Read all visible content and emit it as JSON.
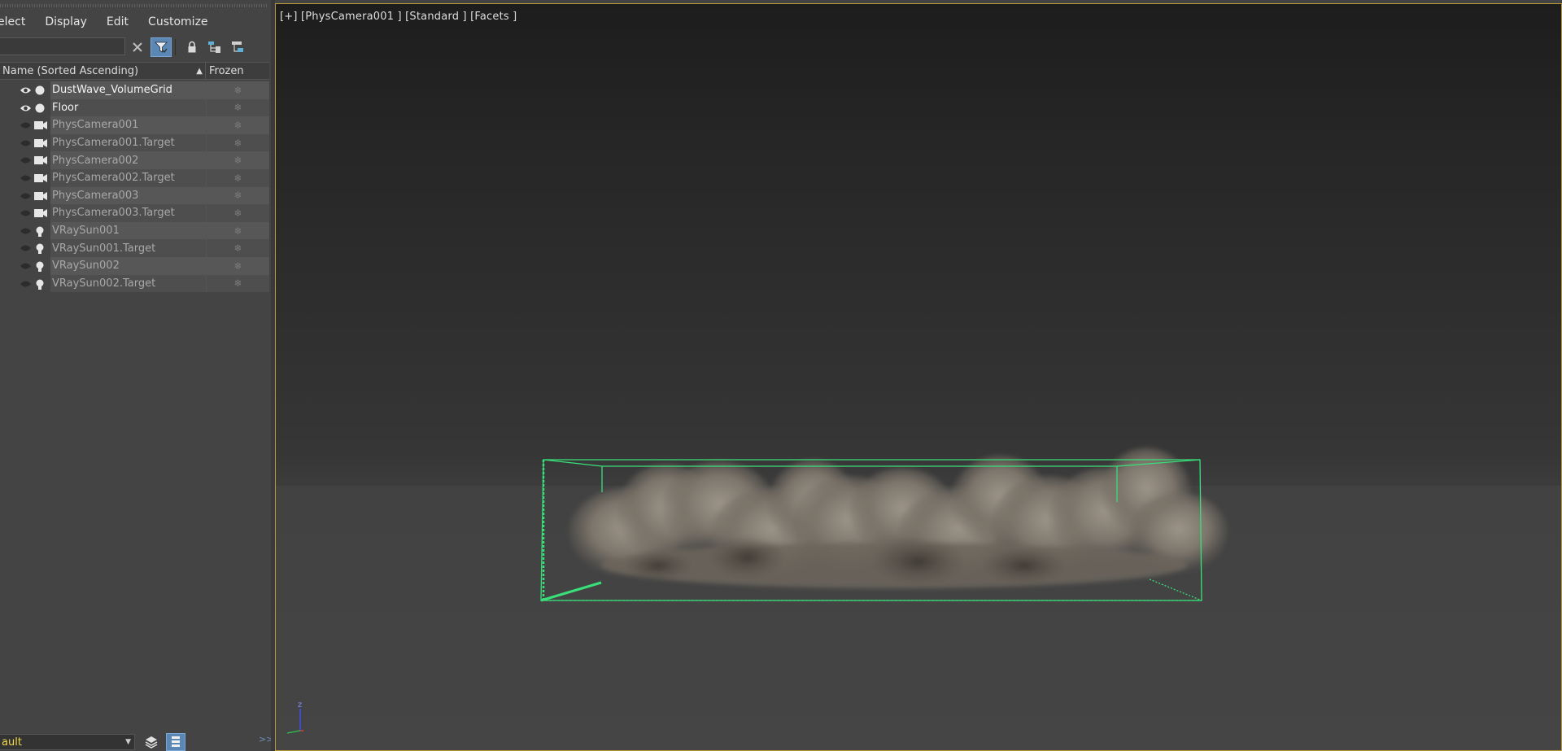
{
  "menu": {
    "select": "elect",
    "display": "Display",
    "edit": "Edit",
    "customize": "Customize"
  },
  "search": {
    "value": "",
    "placeholder": ""
  },
  "columns": {
    "name": "Name (Sorted Ascending)",
    "sort_indicator": "▲",
    "frozen": "Frozen"
  },
  "objects": [
    {
      "name": "DustWave_VolumeGrid",
      "icon": "sphere-icon",
      "visible": true,
      "frozen_icon": "❄"
    },
    {
      "name": "Floor",
      "icon": "sphere-icon",
      "visible": true,
      "frozen_icon": "❄"
    },
    {
      "name": "PhysCamera001",
      "icon": "camera-icon",
      "visible": false,
      "frozen_icon": "❄"
    },
    {
      "name": "PhysCamera001.Target",
      "icon": "camera-icon",
      "visible": false,
      "frozen_icon": "❄"
    },
    {
      "name": "PhysCamera002",
      "icon": "camera-icon",
      "visible": false,
      "frozen_icon": "❄"
    },
    {
      "name": "PhysCamera002.Target",
      "icon": "camera-icon",
      "visible": false,
      "frozen_icon": "❄"
    },
    {
      "name": "PhysCamera003",
      "icon": "camera-icon",
      "visible": false,
      "frozen_icon": "❄"
    },
    {
      "name": "PhysCamera003.Target",
      "icon": "camera-icon",
      "visible": false,
      "frozen_icon": "❄"
    },
    {
      "name": "VRaySun001",
      "icon": "light-bulb-icon",
      "visible": false,
      "frozen_icon": "❄"
    },
    {
      "name": "VRaySun001.Target",
      "icon": "light-bulb-icon",
      "visible": false,
      "frozen_icon": "❄"
    },
    {
      "name": "VRaySun002",
      "icon": "light-bulb-icon",
      "visible": false,
      "frozen_icon": "❄"
    },
    {
      "name": "VRaySun002.Target",
      "icon": "light-bulb-icon",
      "visible": false,
      "frozen_icon": "❄"
    }
  ],
  "bottom": {
    "layer": "ault",
    "expand": ">>"
  },
  "viewport": {
    "label": "[+] [PhysCamera001 ] [Standard ] [Facets ]",
    "axis_z": "z"
  },
  "colors": {
    "accent_blue": "#5b87b5",
    "viewport_border": "#b89a3a",
    "bbox_green": "#39e07a",
    "layer_text": "#f1d94a"
  }
}
